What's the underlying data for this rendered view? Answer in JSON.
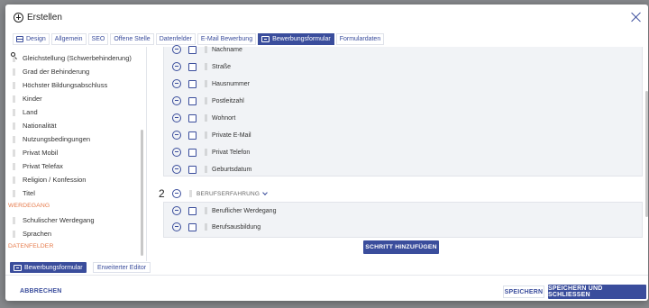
{
  "header": {
    "title": "Erstellen"
  },
  "tabs": [
    {
      "label": "Design"
    },
    {
      "label": "Allgemein"
    },
    {
      "label": "SEO"
    },
    {
      "label": "Offene Stelle"
    },
    {
      "label": "Datenfelder"
    },
    {
      "label": "E-Mail Bewerbung"
    },
    {
      "label": "Bewerbungsformular",
      "active": true
    },
    {
      "label": "Formulardaten"
    }
  ],
  "left_panel": {
    "items": [
      {
        "label": "Gleichstellung (Schwerbehinderung)"
      },
      {
        "label": "Grad der Behinderung"
      },
      {
        "label": "Höchster Bildungsabschluss"
      },
      {
        "label": "Kinder"
      },
      {
        "label": "Land"
      },
      {
        "label": "Nationalität"
      },
      {
        "label": "Nutzungsbedingungen"
      },
      {
        "label": "Privat Mobil"
      },
      {
        "label": "Privat Telefax"
      },
      {
        "label": "Religion / Konfession"
      },
      {
        "label": "Titel"
      }
    ],
    "section_werdegang": "WERDEGANG",
    "werdegang_items": [
      {
        "label": "Schulischer Werdegang"
      },
      {
        "label": "Sprachen"
      }
    ],
    "section_datenfelder": "DATENFELDER",
    "btn_form": "Bewerbungsformular",
    "btn_editor": "Erweiterter Editor"
  },
  "main": {
    "step1_fields": [
      {
        "label": "Nachname"
      },
      {
        "label": "Straße"
      },
      {
        "label": "Hausnummer"
      },
      {
        "label": "Postleitzahl"
      },
      {
        "label": "Wohnort"
      },
      {
        "label": "Private E-Mail"
      },
      {
        "label": "Privat Telefon"
      },
      {
        "label": "Geburtsdatum"
      }
    ],
    "step2_number": "2",
    "step2_title": "BERUFSERFAHRUNG",
    "step2_fields": [
      {
        "label": "Beruflicher Werdegang"
      },
      {
        "label": "Berufsausbildung"
      }
    ],
    "add_step_label": "SCHRITT HINZUFÜGEN"
  },
  "footer": {
    "cancel": "ABBRECHEN",
    "save": "SPEICHERN",
    "save_close": "SPEICHERN UND SCHLIESSEN"
  },
  "colors": {
    "accent": "#3a4d9c",
    "section": "#e67a4a"
  }
}
